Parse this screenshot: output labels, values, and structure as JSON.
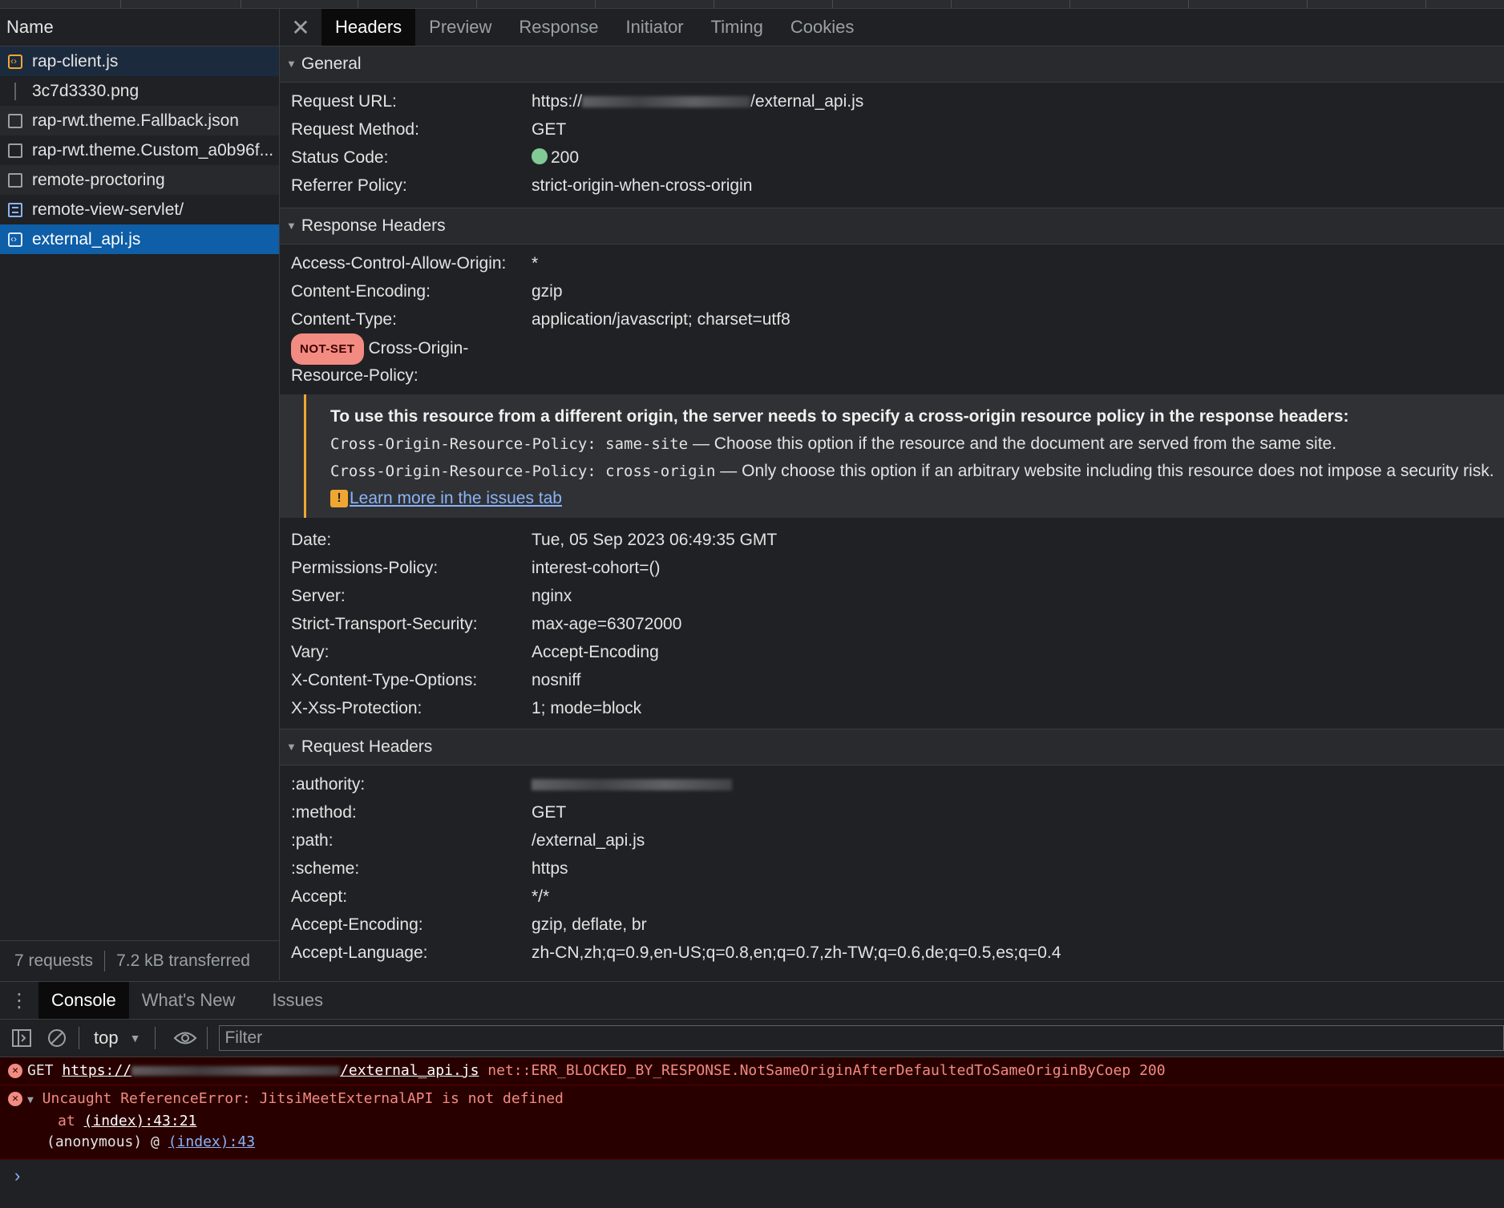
{
  "network_list": {
    "header": "Name",
    "requests": [
      {
        "name": "rap-client.js",
        "type": "js"
      },
      {
        "name": "3c7d3330.png",
        "type": "img"
      },
      {
        "name": "rap-rwt.theme.Fallback.json",
        "type": "other"
      },
      {
        "name": "rap-rwt.theme.Custom_a0b96f...",
        "type": "other"
      },
      {
        "name": "remote-proctoring",
        "type": "other"
      },
      {
        "name": "remote-view-servlet/",
        "type": "doc"
      },
      {
        "name": "external_api.js",
        "type": "js",
        "selected": true
      }
    ],
    "summary": {
      "requests": "7 requests",
      "transferred": "7.2 kB transferred"
    }
  },
  "details": {
    "tabs": [
      "Headers",
      "Preview",
      "Response",
      "Initiator",
      "Timing",
      "Cookies"
    ],
    "active_tab": "Headers",
    "general": {
      "title": "General",
      "request_url_label": "Request URL:",
      "request_url_prefix": "https://",
      "request_url_suffix": "/external_api.js",
      "request_method_label": "Request Method:",
      "request_method": "GET",
      "status_code_label": "Status Code:",
      "status_code": "200",
      "referrer_policy_label": "Referrer Policy:",
      "referrer_policy": "strict-origin-when-cross-origin"
    },
    "response_headers": {
      "title": "Response Headers",
      "before": [
        {
          "k": "Access-Control-Allow-Origin:",
          "v": "*"
        },
        {
          "k": "Content-Encoding:",
          "v": "gzip"
        },
        {
          "k": "Content-Type:",
          "v": "application/javascript; charset=utf8"
        }
      ],
      "corp_badge": "NOT-SET",
      "corp_label_1": "Cross-Origin-",
      "corp_label_2": "Resource-Policy:",
      "warning": {
        "title": "To use this resource from a different origin, the server needs to specify a cross-origin resource policy in the response headers:",
        "line1_code": "Cross-Origin-Resource-Policy: same-site",
        "line1_text": " — Choose this option if the resource and the document are served from the same site.",
        "line2_code": "Cross-Origin-Resource-Policy: cross-origin",
        "line2_text": " — Only choose this option if an arbitrary website including this resource does not impose a security risk.",
        "link": "Learn more in the issues tab"
      },
      "after": [
        {
          "k": "Date:",
          "v": "Tue, 05 Sep 2023 06:49:35 GMT"
        },
        {
          "k": "Permissions-Policy:",
          "v": "interest-cohort=()"
        },
        {
          "k": "Server:",
          "v": "nginx"
        },
        {
          "k": "Strict-Transport-Security:",
          "v": "max-age=63072000"
        },
        {
          "k": "Vary:",
          "v": "Accept-Encoding"
        },
        {
          "k": "X-Content-Type-Options:",
          "v": "nosniff"
        },
        {
          "k": "X-Xss-Protection:",
          "v": "1; mode=block"
        }
      ]
    },
    "request_headers": {
      "title": "Request Headers",
      "authority_label": ":authority:",
      "rows": [
        {
          "k": ":method:",
          "v": "GET"
        },
        {
          "k": ":path:",
          "v": "/external_api.js"
        },
        {
          "k": ":scheme:",
          "v": "https"
        },
        {
          "k": "Accept:",
          "v": "*/*"
        },
        {
          "k": "Accept-Encoding:",
          "v": "gzip, deflate, br"
        },
        {
          "k": "Accept-Language:",
          "v": "zh-CN,zh;q=0.9,en-US;q=0.8,en;q=0.7,zh-TW;q=0.6,de;q=0.5,es;q=0.4"
        }
      ]
    }
  },
  "drawer": {
    "tabs": [
      "Console",
      "What's New",
      "Issues"
    ],
    "active_tab": "Console",
    "context": "top",
    "filter_placeholder": "Filter",
    "errors": {
      "e1_method": "GET",
      "e1_url_prefix": "https://",
      "e1_url_suffix": "/external_api.js",
      "e1_msg": "net::ERR_BLOCKED_BY_RESPONSE.NotSameOriginAfterDefaultedToSameOriginByCoep 200",
      "e2_msg": "Uncaught ReferenceError: JitsiMeetExternalAPI is not defined",
      "e2_at": "at ",
      "e2_loc": "(index):43:21",
      "e2_anon": "(anonymous) @ ",
      "e2_anon_loc": "(index):43"
    },
    "prompt": "›"
  },
  "colors": {
    "background": "#202124",
    "selected_row": "#0e5ea8",
    "status_ok": "#81c995",
    "error_bg": "#290000",
    "error_text": "#f28b82",
    "warning_accent": "#f0a732",
    "link": "#8ab4f8"
  }
}
